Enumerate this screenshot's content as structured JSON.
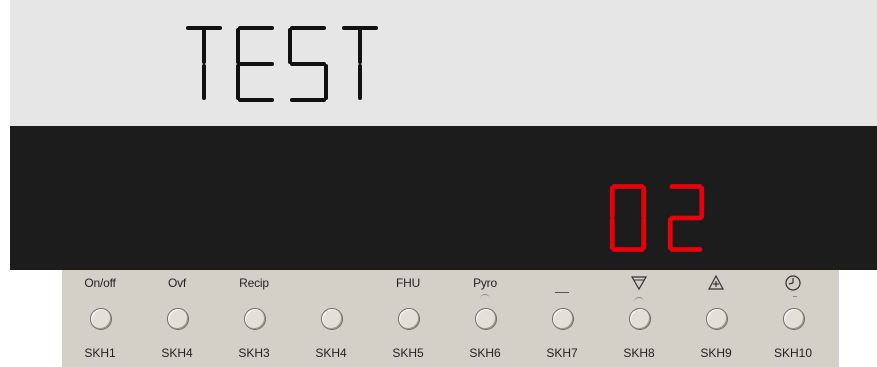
{
  "lcd": {
    "text": "TEST"
  },
  "led": {
    "value": "02",
    "color": "#e8000b"
  },
  "keypad": {
    "keys": [
      {
        "label": "On/off",
        "id": "SKH1"
      },
      {
        "label": "Ovf",
        "id": "SKH4"
      },
      {
        "label": "Recip",
        "id": "SKH3"
      },
      {
        "label": "",
        "id": "SKH4"
      },
      {
        "label": "FHU",
        "id": "SKH5"
      },
      {
        "label": "Pyro",
        "id": "SKH6"
      },
      {
        "label": "",
        "id": "SKH7"
      },
      {
        "label": "",
        "icon": "down-triangle-icon",
        "id": "SKH8"
      },
      {
        "label": "",
        "icon": "up-triangle-plus-icon",
        "id": "SKH9"
      },
      {
        "label": "",
        "icon": "clock-icon",
        "id": "SKH10"
      }
    ]
  }
}
